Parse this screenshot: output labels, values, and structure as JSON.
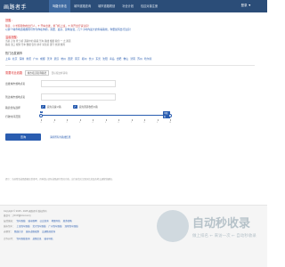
{
  "header": {
    "logo": "画路者手",
    "tabs": [
      "驾路分析法",
      "城市道路查询",
      "城市道路规划",
      "补全计划",
      "包边对接注册"
    ],
    "login": "登录 ▼"
  },
  "tips": {
    "title": "提醒：",
    "lines": [
      "随意、小长假用你的出行人，✈ 开车出发，乘飞机上班，✈ 离开出行请注意！",
      "以算个城市地道路规则可作为你在你的，需要、最高、建筑在位，几个小时内最大的查看路线，你要如何出行注意！"
    ]
  },
  "notice": {
    "title": "温馨提醒：",
    "lines": [
      "当前 正在 查 分析 道路中的 路段 驾车 路线 根据 提供 一 之 通道",
      "路段 出口 规划 驾车 数据 仅供 参考 请注意 遵守 交通 规则"
    ]
  },
  "hot": {
    "title": "热门出发城市",
    "cities": [
      "上海",
      "北京",
      "深圳",
      "重庆",
      "广州",
      "成都",
      "天津",
      "武汉",
      "杭州",
      "西安",
      "南京",
      "郑州",
      "长沙",
      "东莞",
      "沈阳",
      "青岛",
      "合肥",
      "佛山",
      "济南",
      "苏州",
      "哈尔滨"
    ]
  },
  "form": {
    "head_title": "需要可此线路",
    "head_box": "城市/街道名称路径",
    "head_hint": "目标按这样请填",
    "start_label": "出发城市或地点名",
    "end_label": "到达城市或地点名",
    "options_label": "路途优先选择",
    "opt1": "避免高速公路",
    "opt2": "避免国道收费公路",
    "slider_label": "行驶时间范围",
    "slider_start": "0",
    "slider_end": "不限时",
    "tick_labels": [
      "0",
      "1",
      "2",
      "3",
      "4",
      "5",
      "6",
      "7",
      "8",
      "9",
      "10"
    ],
    "submit": "查询",
    "submit_link": "清除所有的路线结果"
  },
  "remark": "提示：当前所查道路数据仅供参考，具体请以实际道路通行情况为准，出行前请关注路况信息及各地交通管制通知。",
  "footer": {
    "copyright": "Copyright © 2015 - 2025 画路者手 版权所有",
    "icp": "备案号：沪ICP备10xxxxx号",
    "links1": [
      "友情链接：",
      "驾车路线",
      "城市路网",
      "公交查询",
      "地图导航",
      "旅游攻略"
    ],
    "links2": [
      "城市驾车：",
      "上海驾车路线",
      "北京驾车路线",
      "广州驾车路线",
      "深圳驾车路线"
    ],
    "links3": [
      "去哪里：",
      "路线大全",
      "城市道路规划",
      "交通路况查询"
    ],
    "links4": [
      "合作伙伴：",
      "驾车路线查询",
      "道路信息",
      "城市导航"
    ]
  },
  "watermark": {
    "title": "自动秒收录",
    "subtitle": "做上排名 ← 来访一次 ← 自动秒收录"
  }
}
